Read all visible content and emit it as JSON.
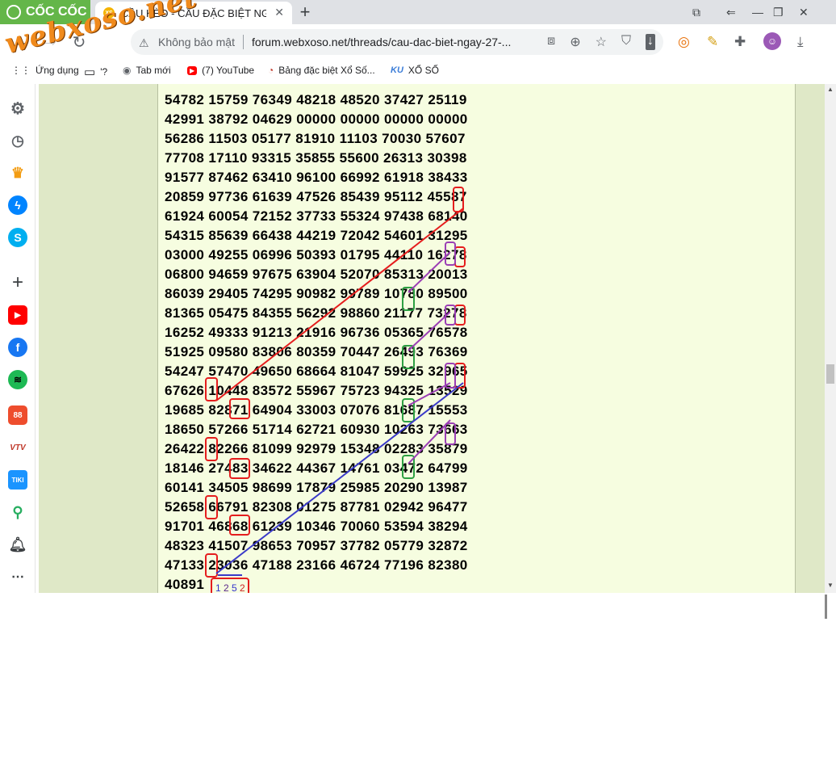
{
  "browser": {
    "brand": "CỐC CỐC",
    "tab": {
      "title": "CẦU KÈO - CẦU ĐẶC BIỆT NGÀY",
      "favicon": "XS"
    },
    "security_label": "Không bảo mật",
    "url": "forum.webxoso.net/threads/cau-dac-biet-ngay-27-..."
  },
  "watermark": "webxoso.net",
  "bookmarks": [
    {
      "label": "Ứng dụng",
      "icon": "apps-icon"
    },
    {
      "label": "'?",
      "icon": "folder-icon"
    },
    {
      "label": "Tab mới",
      "icon": "globe-icon"
    },
    {
      "label": "(7) YouTube",
      "icon": "youtube-icon"
    },
    {
      "label": "Bảng đặc biệt Xổ Số...",
      "icon": "bookmark-site-icon"
    },
    {
      "label": "XỔ SỐ",
      "icon": "ku-icon"
    }
  ],
  "rows": [
    "54782 15759 76349 48218 48520 37427 25119",
    "42991 38792 04629 00000 00000 00000 00000",
    "56286 11503 05177 81910 11103 70030 57607",
    "77708 17110 93315 35855 55600 26313 30398",
    "91577 87462 63410 96100 66992 61918 38433",
    "20859 97736 61639 47526 85439 95112 45587",
    "61924 60054 72152 37733 55324 97438 68140",
    "54315 85639 66438 44219 72042 54601 31295",
    "03000 49255 06996 50393 01795 44110 16278",
    "06800 94659 97675 63904 52070 85313 20013",
    "86039 29405 74295 90982 99789 10780 89500",
    "81365 05475 84355 56292 98860 21177 73278",
    "16252 49333 91213 21916 96736 05365 76578",
    "51925 09580 83806 80359 70447 26493 76369",
    "54247 57470 49650 68664 81047 59925 32965",
    "67626 10448 83572 55967 75723 94325 13529",
    "19685 82871 64904 33003 07076 81687 15553",
    "18650 57266 51714 62721 60930 10263 73663",
    "26422 82266 81099 92979 15348 02283 35879",
    "18146 27483 34622 44367 14761 03472 64799",
    "60141 34505 98699 17879 25985 20290 13987",
    "52658 66791 82308 01275 87781 02942 96477",
    "91701 46868 61239 10346 70060 53594 38294",
    "48323 41507 98653 70957 37782 05779 32872",
    "47133 23036 47188 23166 46724 77196 82380",
    "40891"
  ],
  "result_digits": [
    "1",
    "2",
    "5",
    "2"
  ],
  "result_colors": [
    "#3333cc",
    "#5b2a8c",
    "#3333cc",
    "#cc2222"
  ],
  "colors": {
    "red": "#e51d1d",
    "purple": "#9b3fb5",
    "green": "#2ea043",
    "blue": "#3a3ac8",
    "post_bg": "#f6fde0",
    "side_bg": "#dfe8c7"
  }
}
